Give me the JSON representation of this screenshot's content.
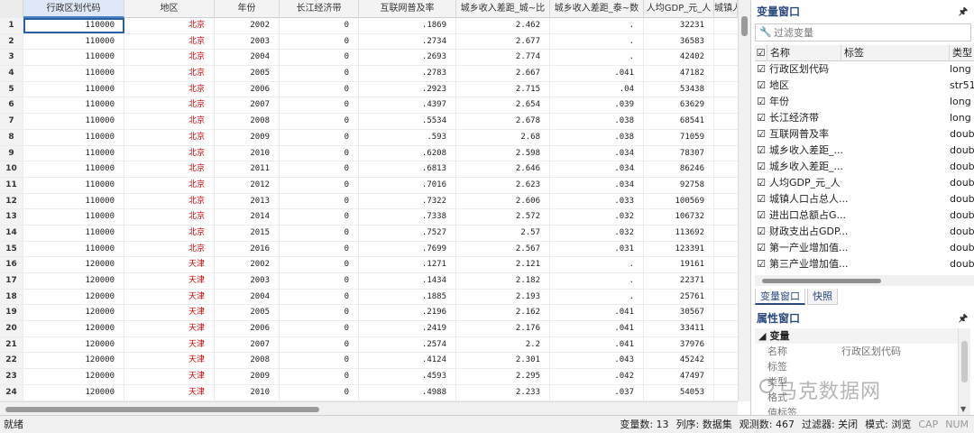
{
  "grid": {
    "columns": [
      {
        "label": "",
        "w": 26
      },
      {
        "label": "行政区划代码",
        "w": 112
      },
      {
        "label": "地区",
        "w": 100
      },
      {
        "label": "年份",
        "w": 72
      },
      {
        "label": "长江经济带",
        "w": 88
      },
      {
        "label": "互联网普及率",
        "w": 108
      },
      {
        "label": "城乡收入差距_城~比",
        "w": 104
      },
      {
        "label": "城乡收入差距_泰~数",
        "w": 104
      },
      {
        "label": "人均GDP_元_人",
        "w": 78
      },
      {
        "label": "城镇人",
        "w": 26
      }
    ],
    "rows": [
      [
        "1",
        "110000",
        "北京",
        "2002",
        "0",
        ".1869",
        "2.462",
        ".",
        "32231"
      ],
      [
        "2",
        "110000",
        "北京",
        "2003",
        "0",
        ".2734",
        "2.677",
        ".",
        "36583"
      ],
      [
        "3",
        "110000",
        "北京",
        "2004",
        "0",
        ".2693",
        "2.774",
        ".",
        "42402"
      ],
      [
        "4",
        "110000",
        "北京",
        "2005",
        "0",
        ".2783",
        "2.667",
        ".041",
        "47182"
      ],
      [
        "5",
        "110000",
        "北京",
        "2006",
        "0",
        ".2923",
        "2.715",
        ".04",
        "53438"
      ],
      [
        "6",
        "110000",
        "北京",
        "2007",
        "0",
        ".4397",
        "2.654",
        ".039",
        "63629"
      ],
      [
        "7",
        "110000",
        "北京",
        "2008",
        "0",
        ".5534",
        "2.678",
        ".038",
        "68541"
      ],
      [
        "8",
        "110000",
        "北京",
        "2009",
        "0",
        ".593",
        "2.68",
        ".038",
        "71059"
      ],
      [
        "9",
        "110000",
        "北京",
        "2010",
        "0",
        ".6208",
        "2.598",
        ".034",
        "78307"
      ],
      [
        "10",
        "110000",
        "北京",
        "2011",
        "0",
        ".6813",
        "2.646",
        ".034",
        "86246"
      ],
      [
        "11",
        "110000",
        "北京",
        "2012",
        "0",
        ".7016",
        "2.623",
        ".034",
        "92758"
      ],
      [
        "12",
        "110000",
        "北京",
        "2013",
        "0",
        ".7322",
        "2.606",
        ".033",
        "100569"
      ],
      [
        "13",
        "110000",
        "北京",
        "2014",
        "0",
        ".7338",
        "2.572",
        ".032",
        "106732"
      ],
      [
        "14",
        "110000",
        "北京",
        "2015",
        "0",
        ".7527",
        "2.57",
        ".032",
        "113692"
      ],
      [
        "15",
        "110000",
        "北京",
        "2016",
        "0",
        ".7699",
        "2.567",
        ".031",
        "123391"
      ],
      [
        "16",
        "120000",
        "天津",
        "2002",
        "0",
        ".1271",
        "2.121",
        ".",
        "19161"
      ],
      [
        "17",
        "120000",
        "天津",
        "2003",
        "0",
        ".1434",
        "2.182",
        ".",
        "22371"
      ],
      [
        "18",
        "120000",
        "天津",
        "2004",
        "0",
        ".1885",
        "2.193",
        ".",
        "25761"
      ],
      [
        "19",
        "120000",
        "天津",
        "2005",
        "0",
        ".2196",
        "2.162",
        ".041",
        "30567"
      ],
      [
        "20",
        "120000",
        "天津",
        "2006",
        "0",
        ".2419",
        "2.176",
        ".041",
        "33411"
      ],
      [
        "21",
        "120000",
        "天津",
        "2007",
        "0",
        ".2574",
        "2.2",
        ".041",
        "37976"
      ],
      [
        "22",
        "120000",
        "天津",
        "2008",
        "0",
        ".4124",
        "2.301",
        ".043",
        "45242"
      ],
      [
        "23",
        "120000",
        "天津",
        "2009",
        "0",
        ".4593",
        "2.295",
        ".042",
        "47497"
      ],
      [
        "24",
        "120000",
        "天津",
        "2010",
        "0",
        ".4988",
        "2.233",
        ".037",
        "54053"
      ]
    ]
  },
  "variables_panel": {
    "title": "变量窗口",
    "pin": "🖈",
    "filter_placeholder": "过滤变量",
    "headers": [
      "名称",
      "标签",
      "类型"
    ],
    "items": [
      {
        "name": "行政区划代码",
        "type": "long"
      },
      {
        "name": "地区",
        "type": "str51"
      },
      {
        "name": "年份",
        "type": "long"
      },
      {
        "name": "长江经济带",
        "type": "long"
      },
      {
        "name": "互联网普及率",
        "type": "doub"
      },
      {
        "name": "城乡收入差距_...",
        "type": "doub"
      },
      {
        "name": "城乡收入差距_...",
        "type": "doub"
      },
      {
        "name": "人均GDP_元_人",
        "type": "doub"
      },
      {
        "name": "城镇人口占总人...",
        "type": "doub"
      },
      {
        "name": "进出口总额占G...",
        "type": "doub"
      },
      {
        "name": "财政支出占GDP...",
        "type": "doub"
      },
      {
        "name": "第一产业增加值...",
        "type": "doub"
      },
      {
        "name": "第三产业增加值...",
        "type": "doub"
      }
    ],
    "tabs": [
      "变量窗口",
      "快照"
    ]
  },
  "properties_panel": {
    "title": "属性窗口",
    "section": "变量",
    "rows": [
      {
        "key": "名称",
        "value": "行政区划代码"
      },
      {
        "key": "标签",
        "value": ""
      },
      {
        "key": "类型",
        "value": ""
      },
      {
        "key": "格式",
        "value": ""
      },
      {
        "key": "值标签",
        "value": ""
      }
    ]
  },
  "watermark": "马克数据网",
  "status": {
    "left": "就绪",
    "vars": "变量数: 13",
    "order": "列序: 数据集",
    "obs": "观测数: 467",
    "filter": "过滤器: 关闭",
    "mode": "模式: 浏览",
    "cap": "CAP",
    "num": "NUM"
  }
}
